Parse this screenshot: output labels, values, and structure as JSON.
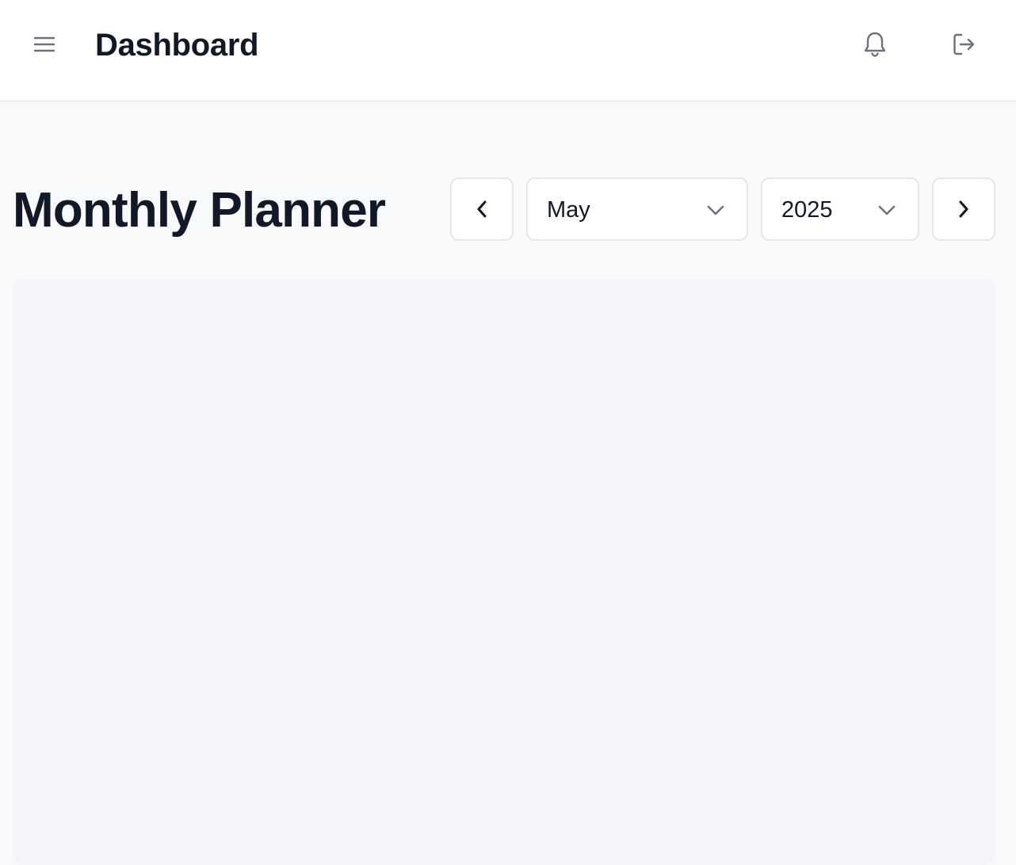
{
  "header": {
    "title": "Dashboard",
    "menu_icon": "hamburger-menu-icon",
    "notifications_icon": "bell-icon",
    "logout_icon": "logout-icon"
  },
  "planner": {
    "title": "Monthly Planner",
    "prev_icon": "chevron-left-icon",
    "next_icon": "chevron-right-icon",
    "month": {
      "selected": "May",
      "chevron_icon": "chevron-down-icon"
    },
    "year": {
      "selected": "2025",
      "chevron_icon": "chevron-down-icon"
    }
  },
  "colors": {
    "page_background": "#f8f9fb",
    "header_background": "#ffffff",
    "text_primary": "#111827",
    "icon_muted": "#6b7280",
    "border": "#e5e7eb",
    "panel_background": "#f4f6f9"
  }
}
